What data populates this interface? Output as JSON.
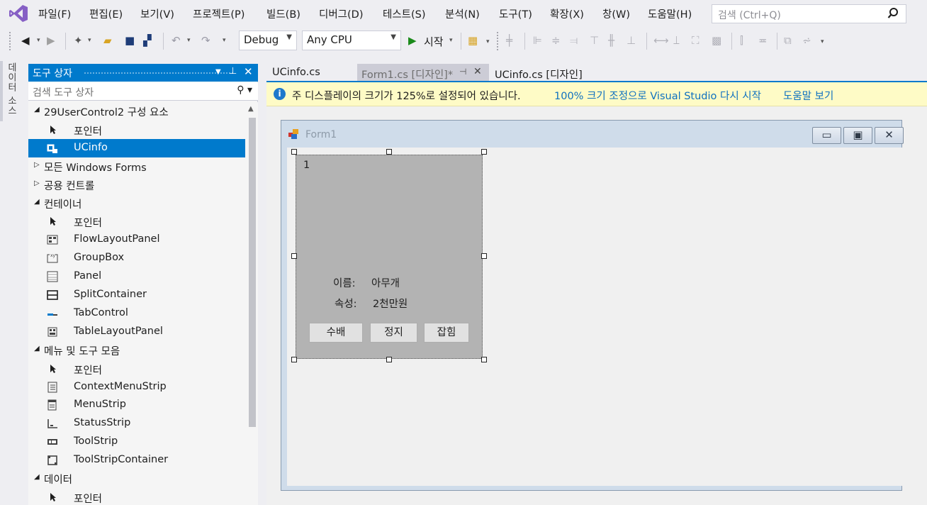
{
  "menu": {
    "items": [
      "파일(F)",
      "편집(E)",
      "보기(V)",
      "프로젝트(P)",
      "빌드(B)",
      "디버그(D)",
      "테스트(S)",
      "분석(N)",
      "도구(T)",
      "확장(X)",
      "창(W)",
      "도움말(H)"
    ],
    "search_placeholder": "검색 (Ctrl+Q)"
  },
  "toolbar": {
    "config": "Debug",
    "platform": "Any CPU",
    "start_label": "시작"
  },
  "side_strip": {
    "label": "데이터 소스"
  },
  "toolbox": {
    "title": "도구 상자",
    "search_placeholder": "검색 도구 상자",
    "rows": [
      {
        "type": "cat",
        "expanded": true,
        "label": "29UserControl2 구성 요소"
      },
      {
        "type": "item",
        "icon": "pointer-icon",
        "label": "포인터"
      },
      {
        "type": "item",
        "icon": "usercontrol-icon",
        "label": "UCinfo",
        "selected": true
      },
      {
        "type": "cat",
        "expanded": false,
        "label": "모든 Windows Forms"
      },
      {
        "type": "cat",
        "expanded": false,
        "label": "공용 컨트롤"
      },
      {
        "type": "cat",
        "expanded": true,
        "label": "컨테이너"
      },
      {
        "type": "item",
        "icon": "pointer-icon",
        "label": "포인터"
      },
      {
        "type": "item",
        "icon": "flowlayoutpanel-icon",
        "label": "FlowLayoutPanel"
      },
      {
        "type": "item",
        "icon": "groupbox-icon",
        "label": "GroupBox"
      },
      {
        "type": "item",
        "icon": "panel-icon",
        "label": "Panel"
      },
      {
        "type": "item",
        "icon": "splitcontainer-icon",
        "label": "SplitContainer"
      },
      {
        "type": "item",
        "icon": "tabcontrol-icon",
        "label": "TabControl"
      },
      {
        "type": "item",
        "icon": "tablelayoutpanel-icon",
        "label": "TableLayoutPanel"
      },
      {
        "type": "cat",
        "expanded": true,
        "label": "메뉴 및 도구 모음"
      },
      {
        "type": "item",
        "icon": "pointer-icon",
        "label": "포인터"
      },
      {
        "type": "item",
        "icon": "contextmenustrip-icon",
        "label": "ContextMenuStrip"
      },
      {
        "type": "item",
        "icon": "menustrip-icon",
        "label": "MenuStrip"
      },
      {
        "type": "item",
        "icon": "statusstrip-icon",
        "label": "StatusStrip"
      },
      {
        "type": "item",
        "icon": "toolstrip-icon",
        "label": "ToolStrip"
      },
      {
        "type": "item",
        "icon": "toolstripcontainer-icon",
        "label": "ToolStripContainer"
      },
      {
        "type": "cat",
        "expanded": true,
        "label": "데이터"
      },
      {
        "type": "item",
        "icon": "pointer-icon",
        "label": "포인터"
      }
    ]
  },
  "doc_tabs": [
    {
      "label": "UCinfo.cs",
      "state": "normal"
    },
    {
      "label": "Form1.cs [디자인]*",
      "state": "preview"
    },
    {
      "label": "UCinfo.cs [디자인]",
      "state": "normal"
    }
  ],
  "infobar": {
    "message": "주 디스플레이의 크기가 125%로 설정되어 있습니다.",
    "link_restart": "100% 크기 조정으로 Visual Studio 다시 시작",
    "link_help": "도움말 보기"
  },
  "form": {
    "title": "Form1",
    "usercontrol": {
      "number_label": "1",
      "name_caption": "이름:",
      "name_value": "아무개",
      "attr_caption": "속성:",
      "attr_value": "2천만원",
      "buttons": [
        "수배",
        "정지",
        "잡힘"
      ]
    }
  },
  "colors": {
    "accent": "#007acc",
    "infobar_bg": "#fefbc6",
    "link": "#0e70c0",
    "usercontrol_bg": "#b3b3b3"
  }
}
